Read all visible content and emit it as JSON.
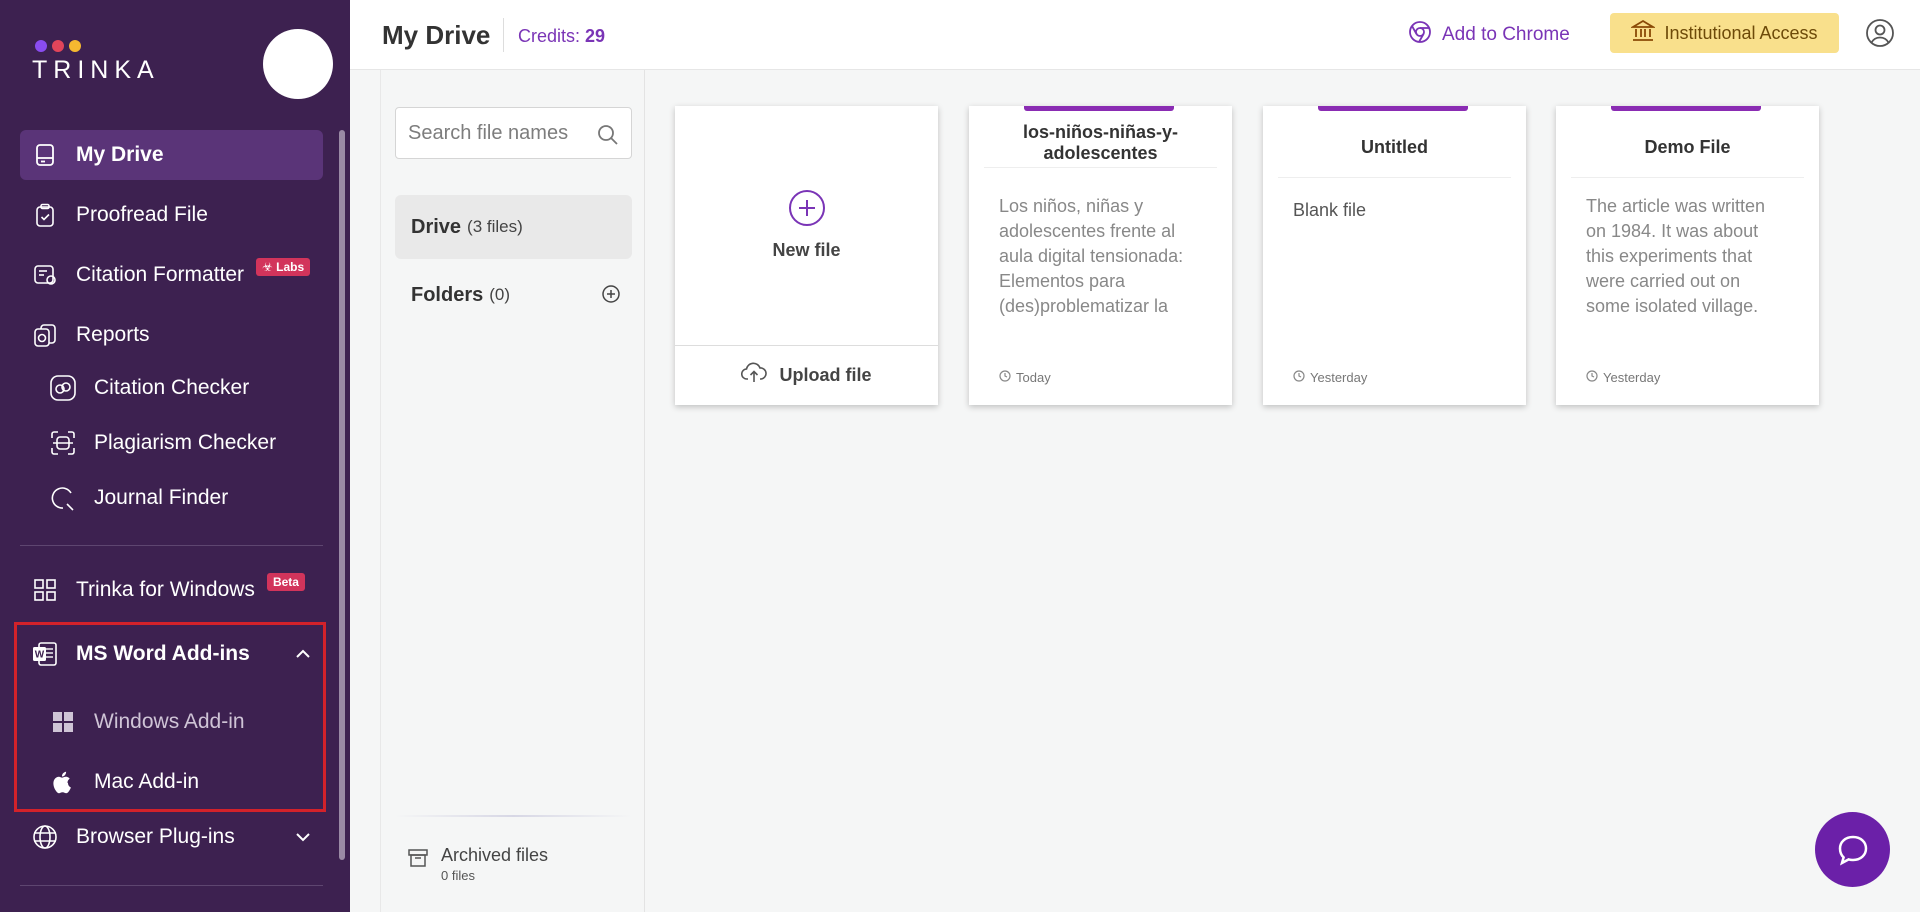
{
  "brand": {
    "name": "TRINKA",
    "dot_colors": [
      "#8a4cf0",
      "#e2455a",
      "#f5b830"
    ]
  },
  "sidebar": {
    "items": [
      {
        "label": "My Drive"
      },
      {
        "label": "Proofread File"
      },
      {
        "label": "Citation Formatter",
        "badge": "Labs"
      },
      {
        "label": "Reports"
      },
      {
        "label": "Citation Checker"
      },
      {
        "label": "Plagiarism Checker"
      },
      {
        "label": "Journal Finder"
      },
      {
        "label": "Trinka for Windows",
        "badge": "Beta"
      },
      {
        "label": "MS Word Add-ins"
      },
      {
        "label": "Windows Add-in"
      },
      {
        "label": "Mac Add-in"
      },
      {
        "label": "Browser Plug-ins"
      }
    ]
  },
  "header": {
    "title": "My Drive",
    "credits_label": "Credits:",
    "credits_value": "29",
    "add_to_chrome": "Add to Chrome",
    "institutional_access": "Institutional Access"
  },
  "panel": {
    "search_placeholder": "Search file names",
    "drive_label": "Drive",
    "drive_count": "(3 files)",
    "folders_label": "Folders",
    "folders_count": "(0)",
    "archived_label": "Archived files",
    "archived_count": "0 files"
  },
  "cards": {
    "new_file": "New file",
    "upload_file": "Upload file",
    "files": [
      {
        "title": "los-niños-niñas-y-adolescentes",
        "preview": "Los niños, niñas y adolescentes frente al aula digital tensionada: Elementos para (des)problematizar la escuela Resumen El",
        "time": "Today"
      },
      {
        "title": "Untitled",
        "preview": "Blank file",
        "time": "Yesterday"
      },
      {
        "title": "Demo File",
        "preview": "The article was written on 1984. It was about this experiments that were carried out on some isolated village. The villages (Lulbushki)",
        "time": "Yesterday"
      }
    ]
  },
  "colors": {
    "sidebar_bg": "#3d2150",
    "accent": "#7a34b6",
    "highlight": "#d3222a",
    "inst_bg": "#f9e08c"
  }
}
